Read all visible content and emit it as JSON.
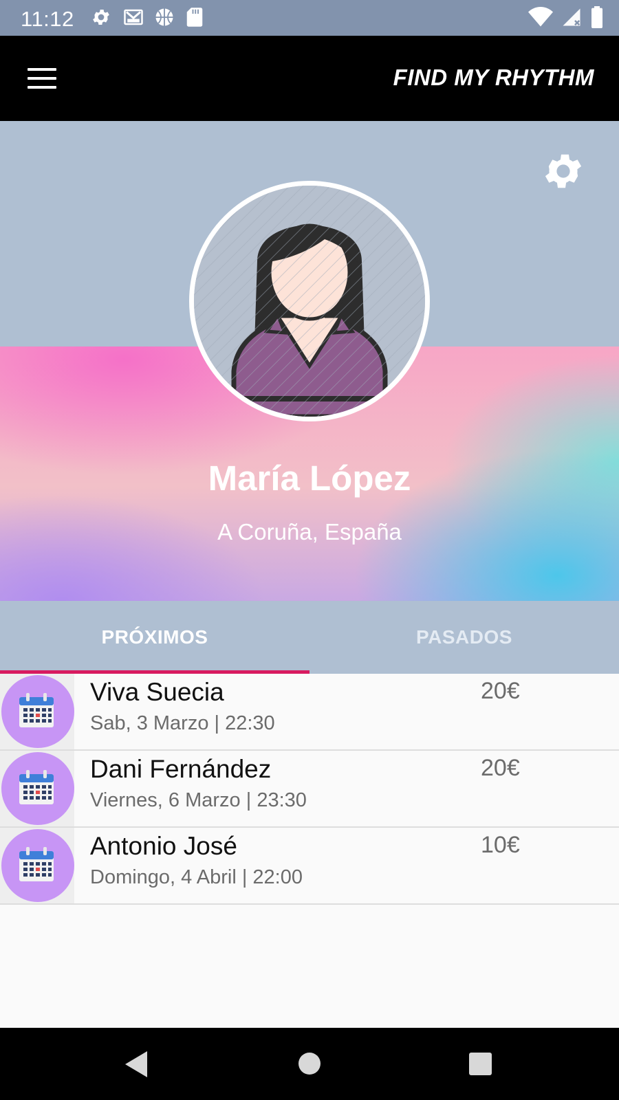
{
  "status_bar": {
    "time": "11:12",
    "icons": [
      "settings-icon",
      "gmail-icon",
      "basketball-icon",
      "sd-card-icon",
      "wifi-icon",
      "signal-icon",
      "battery-icon"
    ]
  },
  "app_bar": {
    "title": "FIND MY RHYTHM",
    "menu_icon": "hamburger-menu-icon"
  },
  "profile": {
    "name": "María López",
    "location": "A Coruña, España",
    "avatar_icon": "female-avatar-icon",
    "settings_icon": "gear-icon"
  },
  "tabs": [
    {
      "label": "PRÓXIMOS",
      "selected": true
    },
    {
      "label": "PASADOS",
      "selected": false
    }
  ],
  "events": [
    {
      "name": "Viva Suecia",
      "date": "Sab, 3 Marzo | 22:30",
      "price": "20€",
      "icon": "calendar-icon"
    },
    {
      "name": "Dani Fernández",
      "date": "Viernes, 6 Marzo | 23:30",
      "price": "20€",
      "icon": "calendar-icon"
    },
    {
      "name": "Antonio José",
      "date": "Domingo, 4 Abril | 22:00",
      "price": "10€",
      "icon": "calendar-icon"
    }
  ],
  "colors": {
    "status_bar": "#8293ad",
    "app_bar": "#000000",
    "header": "#afbfd2",
    "tab_indicator": "#d81b60",
    "event_icon_bg": "#c795f5"
  },
  "nav_bar": {
    "icons": [
      "back-icon",
      "home-icon",
      "recents-icon"
    ]
  }
}
